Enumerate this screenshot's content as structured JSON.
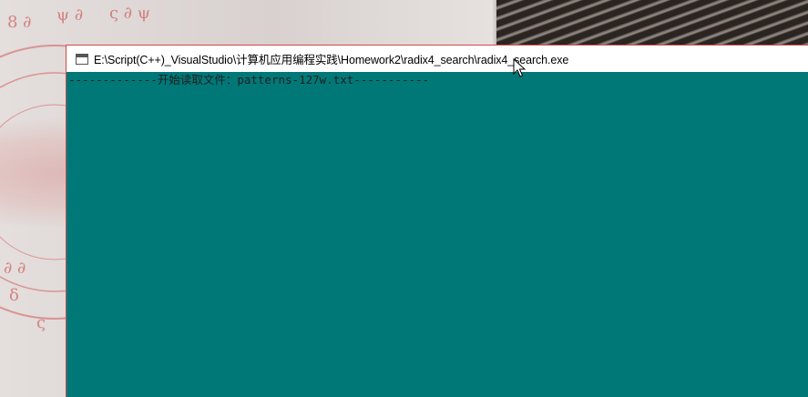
{
  "window": {
    "title": "E:\\Script(C++)_VisualStudio\\计算机应用编程实践\\Homework2\\radix4_search\\radix4_search.exe",
    "app_icon": "console-window-icon"
  },
  "console": {
    "lines": [
      "-------------开始读取文件：patterns-127w.txt-----------"
    ],
    "background_color": "#007878",
    "text_color": "#1e1e1e"
  },
  "cursor": {
    "icon": "arrow-pointer-icon"
  }
}
